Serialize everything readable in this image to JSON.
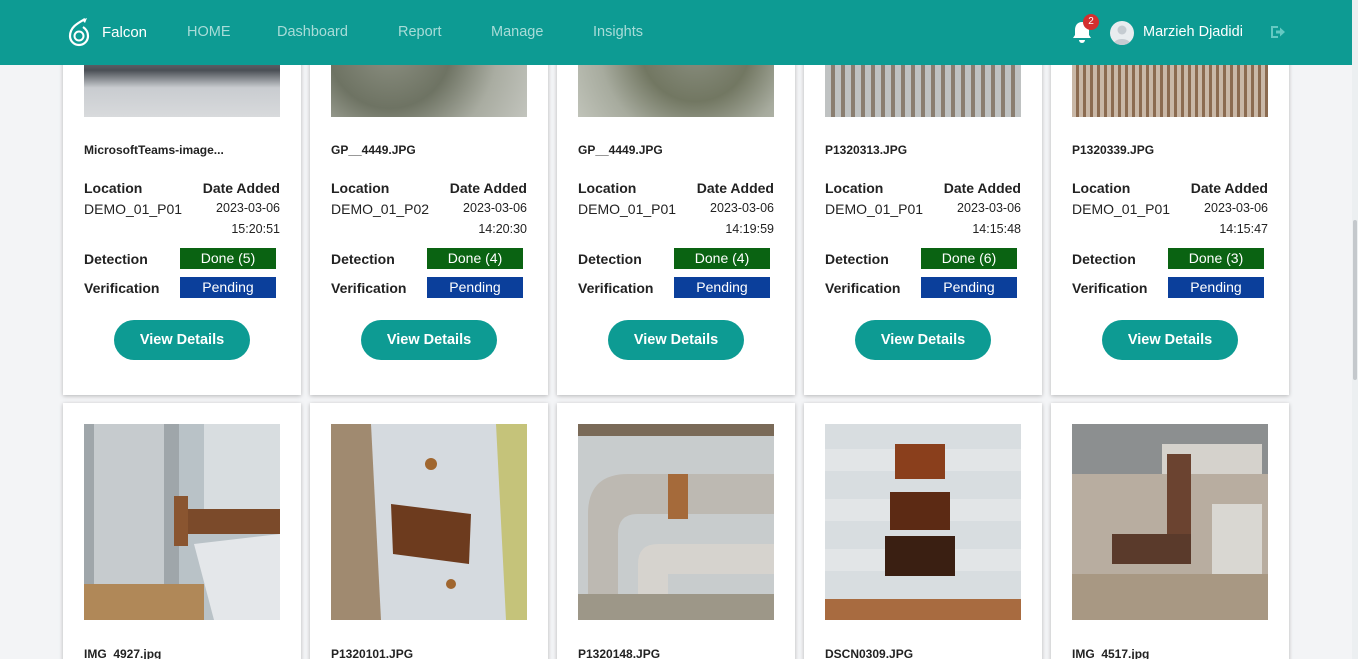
{
  "app": {
    "name": "Falcon"
  },
  "nav": {
    "items": [
      "HOME",
      "Dashboard",
      "Report",
      "Manage",
      "Insights"
    ]
  },
  "notifications": {
    "count": "2"
  },
  "user": {
    "name": "Marzieh Djadidi"
  },
  "labels": {
    "location": "Location",
    "date_added": "Date Added",
    "detection": "Detection",
    "verification": "Verification",
    "view_details": "View Details"
  },
  "colors": {
    "primary": "#0d9b93",
    "done": "#0a6312",
    "pending": "#0b3f9b",
    "badge": "#d32f2f"
  },
  "cards_row1": [
    {
      "file": "MicrosoftTeams-image...",
      "location": "DEMO_01_P01",
      "date": "2023-03-06",
      "time": "15:20:51",
      "detection": "Done (5)",
      "verification": "Pending"
    },
    {
      "file": "GP__4449.JPG",
      "location": "DEMO_01_P02",
      "date": "2023-03-06",
      "time": "14:20:30",
      "detection": "Done (4)",
      "verification": "Pending"
    },
    {
      "file": "GP__4449.JPG",
      "location": "DEMO_01_P01",
      "date": "2023-03-06",
      "time": "14:19:59",
      "detection": "Done (4)",
      "verification": "Pending"
    },
    {
      "file": "P1320313.JPG",
      "location": "DEMO_01_P01",
      "date": "2023-03-06",
      "time": "14:15:48",
      "detection": "Done (6)",
      "verification": "Pending"
    },
    {
      "file": "P1320339.JPG",
      "location": "DEMO_01_P01",
      "date": "2023-03-06",
      "time": "14:15:47",
      "detection": "Done (3)",
      "verification": "Pending"
    }
  ],
  "cards_row2": [
    {
      "file": "IMG_4927.jpg"
    },
    {
      "file": "P1320101.JPG"
    },
    {
      "file": "P1320148.JPG"
    },
    {
      "file": "DSCN0309.JPG"
    },
    {
      "file": "IMG_4517.jpg"
    }
  ]
}
